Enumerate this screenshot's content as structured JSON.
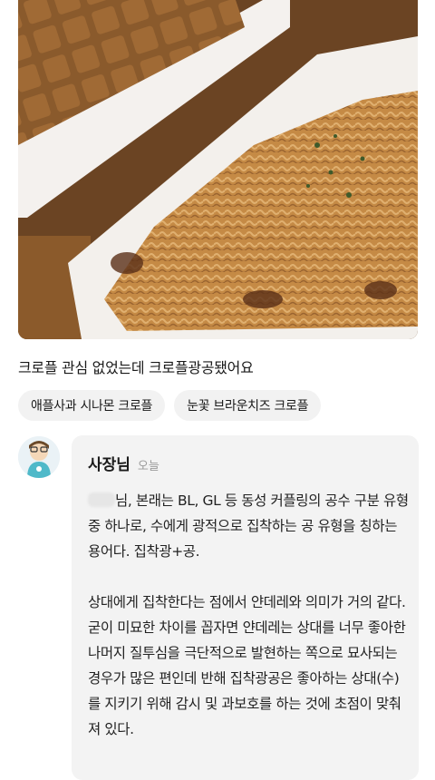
{
  "review": {
    "caption": "크로플 관심 없었는데 크로플광공됐어요",
    "tags": [
      "애플사과 시나몬 크로플",
      "눈꽃 브라운치즈 크로플"
    ]
  },
  "reply": {
    "owner_name": "사장님",
    "time": "오늘",
    "para1": "님, 본래는 BL, GL 등 동성 커플링의 공수 구분 유형 중 하나로, 수에게 광적으로 집착하는 공 유형을 칭하는 용어다. 집착광+공.",
    "para2": "상대에게 집착한다는 점에서 얀데레와 의미가 거의 같다. 굳이 미묘한 차이를 꼽자면 얀데레는 상대를 너무 좋아한 나머지 질투심을 극단적으로 발현하는 쪽으로 묘사되는 경우가 많은 편인데 반해 집착광공은 좋아하는 상대(수)를 지키기 위해 감시 및 과보호를 하는 것에 초점이 맞춰져 있다."
  }
}
